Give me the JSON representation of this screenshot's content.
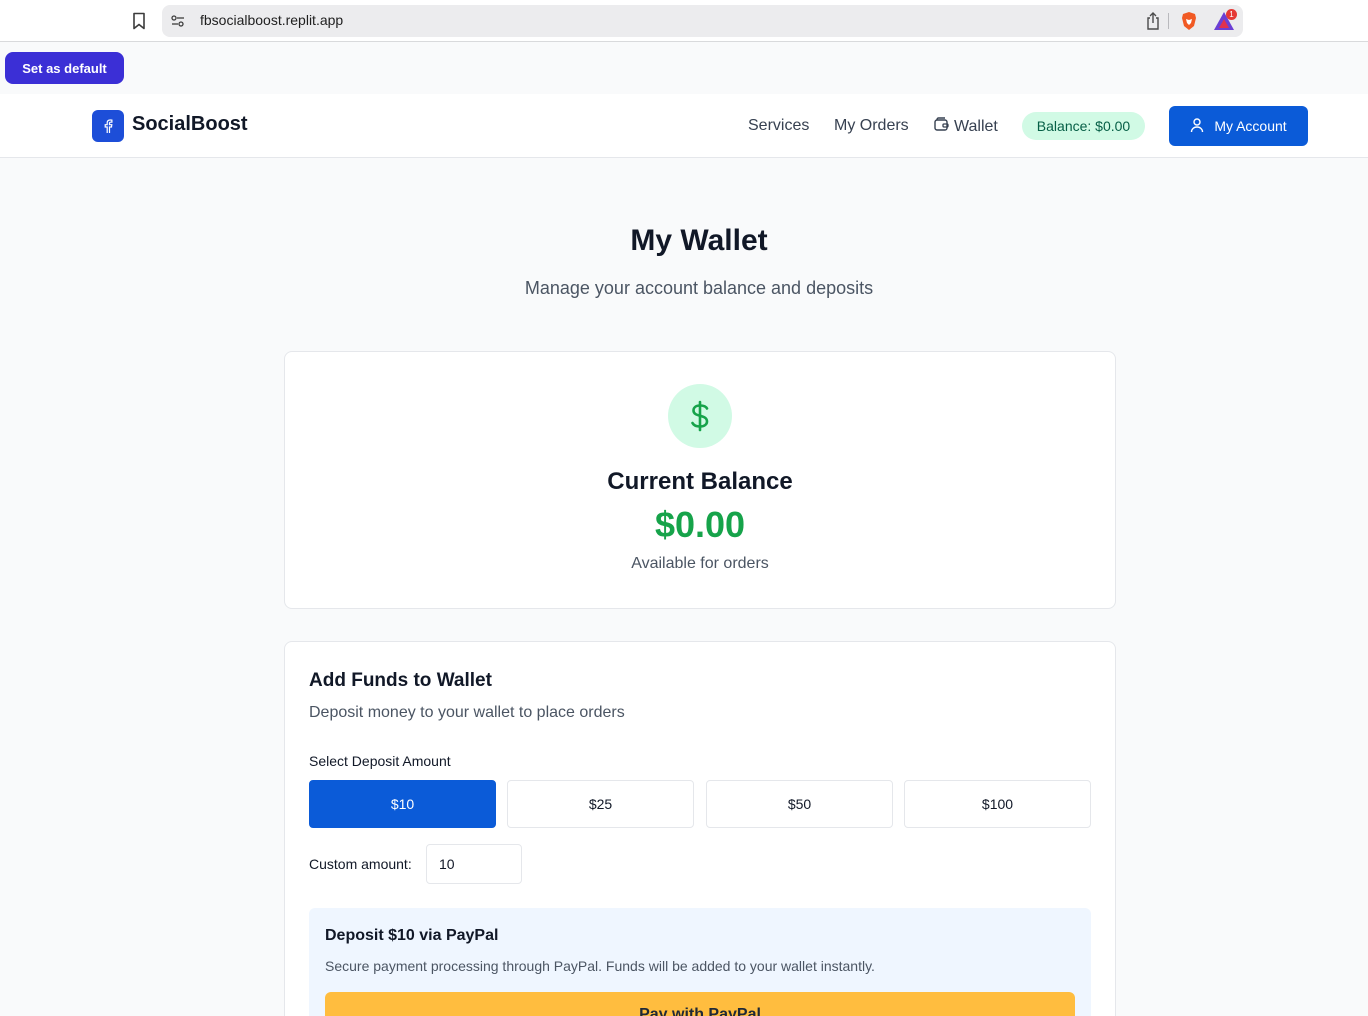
{
  "browser": {
    "url": "fbsocialboost.replit.app",
    "rewards_badge": "1",
    "set_default_label": "Set as default"
  },
  "header": {
    "logo_text": "SocialBoost",
    "nav": {
      "services": "Services",
      "orders": "My Orders",
      "wallet": "Wallet"
    },
    "balance_pill": "Balance: $0.00",
    "account_label": "My Account"
  },
  "page": {
    "title": "My Wallet",
    "subtitle": "Manage your account balance and deposits"
  },
  "balance_card": {
    "label": "Current Balance",
    "amount": "$0.00",
    "note": "Available for orders"
  },
  "funds_card": {
    "title": "Add Funds to Wallet",
    "description": "Deposit money to your wallet to place orders",
    "select_label": "Select Deposit Amount",
    "amounts": [
      "$10",
      "$25",
      "$50",
      "$100"
    ],
    "selected_amount": "$10",
    "custom_label": "Custom amount:",
    "custom_value": "10",
    "paypal": {
      "title": "Deposit $10 via PayPal",
      "description": "Secure payment processing through PayPal. Funds will be added to your wallet instantly.",
      "button_label": "Pay with PayPal"
    }
  },
  "colors": {
    "primary": "#0b5bd8",
    "success": "#16a34a",
    "balance_pill_bg": "#d1fae5",
    "paypal_yellow": "#ffbd3f"
  }
}
